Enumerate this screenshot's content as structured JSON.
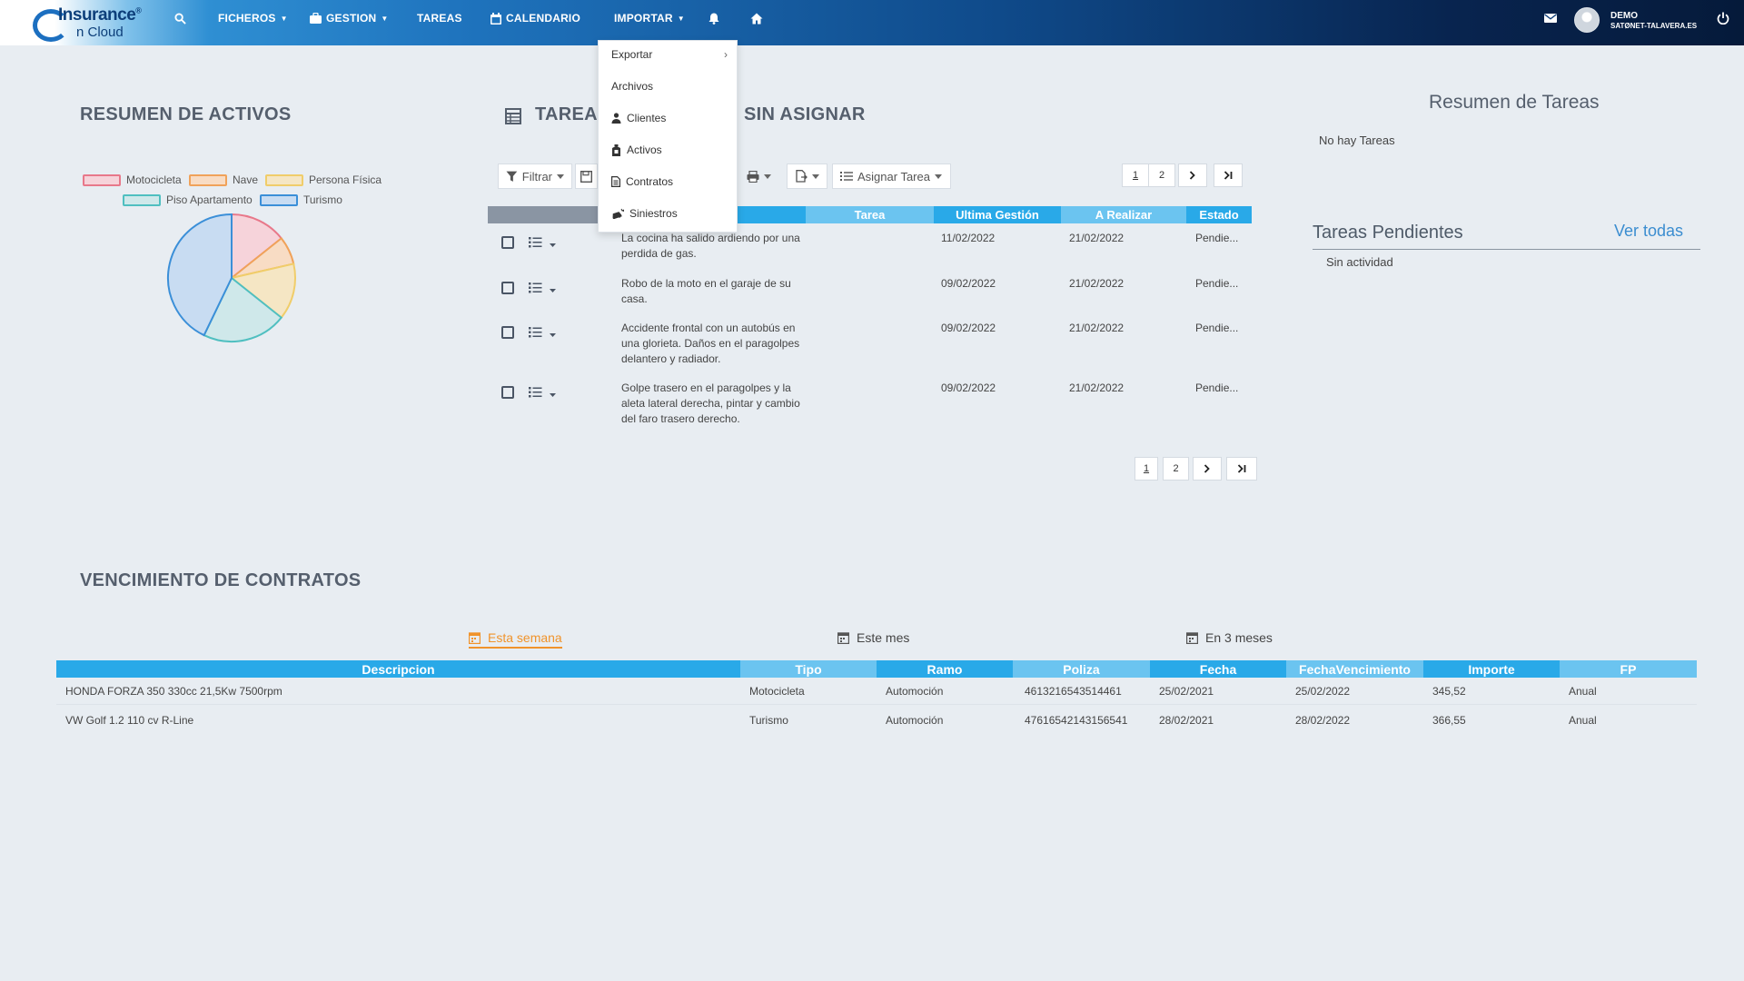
{
  "nav": {
    "logo_line1": "Insurance",
    "logo_reg": "®",
    "logo_line2": "n Cloud",
    "ficheros": "FICHEROS",
    "gestion": "GESTION",
    "tareas": "TAREAS",
    "calendario": "CALENDARIO",
    "importar": "IMPORTAR",
    "user_name": "DEMO",
    "user_domain": "SATØNET-TALAVERA.ES"
  },
  "dropdown": {
    "items": [
      {
        "label": "Exportar",
        "icon": "",
        "submenu": true
      },
      {
        "label": "Archivos",
        "icon": ""
      },
      {
        "label": "Clientes",
        "icon": "person-icon"
      },
      {
        "label": "Activos",
        "icon": "asset-icon"
      },
      {
        "label": "Contratos",
        "icon": "document-icon"
      },
      {
        "label": "Siniestros",
        "icon": "car-crash-icon"
      }
    ]
  },
  "activos": {
    "title": "RESUMEN DE ACTIVOS",
    "legend": [
      {
        "label": "Motocicleta",
        "color": "#e8788a",
        "fill": "#f6d3da"
      },
      {
        "label": "Nave",
        "color": "#f0a25a",
        "fill": "#f8dcc4"
      },
      {
        "label": "Persona Física",
        "color": "#f0cd6a",
        "fill": "#f5e6c4"
      },
      {
        "label": "Piso Apartamento",
        "color": "#4fbfc0",
        "fill": "#cfe8ea"
      },
      {
        "label": "Turismo",
        "color": "#3b8fd8",
        "fill": "#c8dcf2"
      }
    ]
  },
  "chart_data": {
    "type": "pie",
    "categories": [
      "Motocicleta",
      "Nave",
      "Persona Física",
      "Piso Apartamento",
      "Turismo"
    ],
    "values": [
      1,
      0.5,
      1,
      1.5,
      3
    ],
    "colors": [
      "#e8788a",
      "#f0a25a",
      "#f0cd6a",
      "#4fbfc0",
      "#3b8fd8"
    ],
    "fills": [
      "#f6d3da",
      "#f8dcc4",
      "#f5e6c4",
      "#cfe8ea",
      "#c8dcf2"
    ],
    "title": "",
    "legend_position": "top"
  },
  "tareas": {
    "title_left": "TAREA",
    "title_right": "SIN ASIGNAR",
    "filter_label": "Filtrar",
    "assign_label": "Asignar Tarea",
    "pages": [
      "1",
      "2"
    ],
    "headers": [
      "Tarea",
      "Ultima Gestión",
      "A Realizar",
      "Estado"
    ],
    "rows": [
      {
        "desc": "La cocina ha salido ardiendo por una perdida de gas.",
        "ultima": "11/02/2022",
        "realizar": "21/02/2022",
        "estado": "Pendie..."
      },
      {
        "desc": "Robo de la moto en el garaje de su casa.",
        "ultima": "09/02/2022",
        "realizar": "21/02/2022",
        "estado": "Pendie..."
      },
      {
        "desc": "Accidente frontal con un autobús en una glorieta. Daños en el paragolpes delantero y radiador.",
        "ultima": "09/02/2022",
        "realizar": "21/02/2022",
        "estado": "Pendie..."
      },
      {
        "desc": "Golpe trasero en el paragolpes y la aleta lateral derecha, pintar y cambio del faro trasero derecho.",
        "ultima": "09/02/2022",
        "realizar": "21/02/2022",
        "estado": "Pendie..."
      }
    ]
  },
  "resumen": {
    "title": "Resumen de Tareas",
    "empty": "No hay Tareas",
    "pendientes_title": "Tareas Pendientes",
    "ver_todas": "Ver todas",
    "sin_actividad": "Sin actividad"
  },
  "contratos": {
    "title": "VENCIMIENTO DE CONTRATOS",
    "tabs": [
      "Esta semana",
      "Este mes",
      "En 3 meses"
    ],
    "active_tab_color": "#f0932b",
    "headers": [
      "Descripcion",
      "Tipo",
      "Ramo",
      "Poliza",
      "Fecha",
      "FechaVencimiento",
      "Importe",
      "FP"
    ],
    "rows": [
      [
        "HONDA FORZA 350 330cc 21,5Kw 7500rpm",
        "Motocicleta",
        "Automoción",
        "4613216543514461",
        "25/02/2021",
        "25/02/2022",
        "345,52",
        "Anual"
      ],
      [
        "VW Golf 1.2 110 cv R-Line",
        "Turismo",
        "Automoción",
        "47616542143156541",
        "28/02/2021",
        "28/02/2022",
        "366,55",
        "Anual"
      ]
    ]
  }
}
